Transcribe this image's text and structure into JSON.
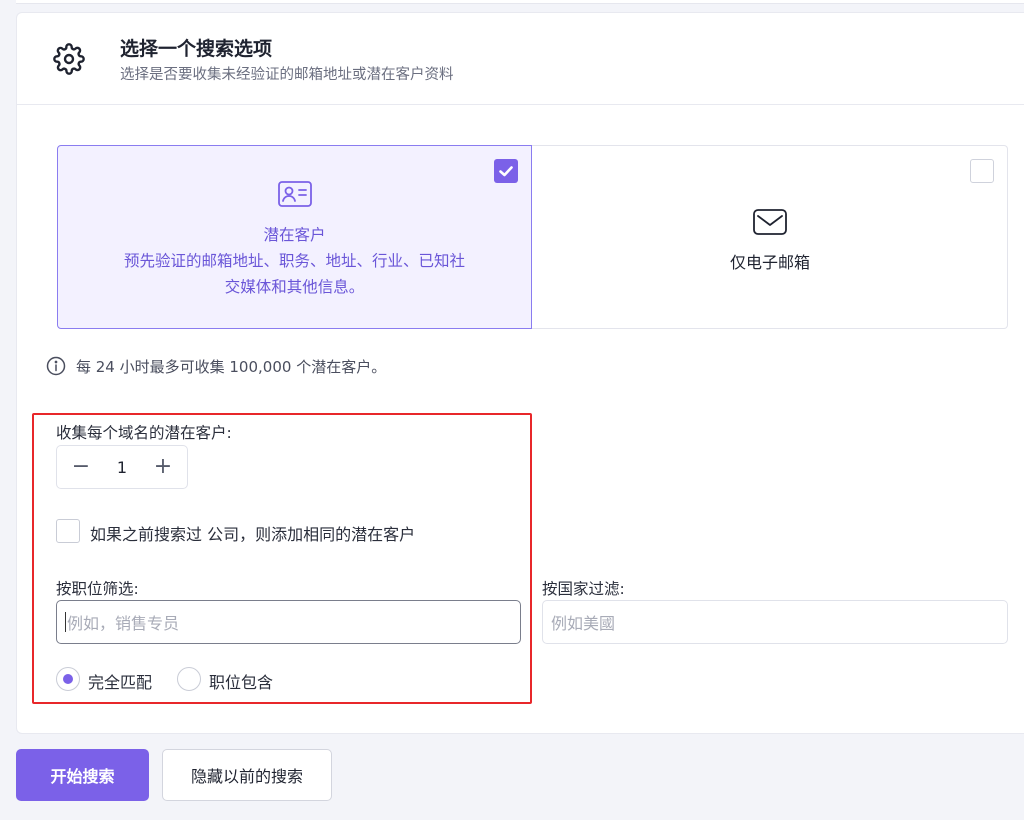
{
  "header": {
    "title": "选择一个搜索选项",
    "subtitle": "选择是否要收集未经验证的邮箱地址或潜在客户资料",
    "icon": "gear-icon"
  },
  "options": {
    "leads": {
      "icon": "id-card-icon",
      "line1": "潜在客户",
      "line2": "预先验证的邮箱地址、职务、地址、行业、已知社",
      "line3": "交媒体和其他信息。",
      "checked": true
    },
    "email": {
      "icon": "envelope-icon",
      "label": "仅电子邮箱",
      "checked": false
    }
  },
  "info": {
    "icon": "info-icon",
    "text": "每 24 小时最多可收集 100,000 个潜在客户。"
  },
  "per_domain": {
    "label": "收集每个域名的潜在客户:",
    "value": "1",
    "minus": "−",
    "plus": "+"
  },
  "repeat_company": {
    "label": "如果之前搜索过 公司，则添加相同的潜在客户",
    "checked": false
  },
  "title_filter": {
    "label": "按职位筛选:",
    "placeholder": "例如，销售专员"
  },
  "country_filter": {
    "label": "按国家过滤:",
    "placeholder": "例如美國"
  },
  "match_mode": {
    "options": [
      "完全匹配",
      "职位包含"
    ],
    "selected": "完全匹配"
  },
  "actions": {
    "start": "开始搜索",
    "hide_previous": "隐藏以前的搜索"
  },
  "colors": {
    "accent": "#7b61e8",
    "highlight": "#e8272a"
  }
}
